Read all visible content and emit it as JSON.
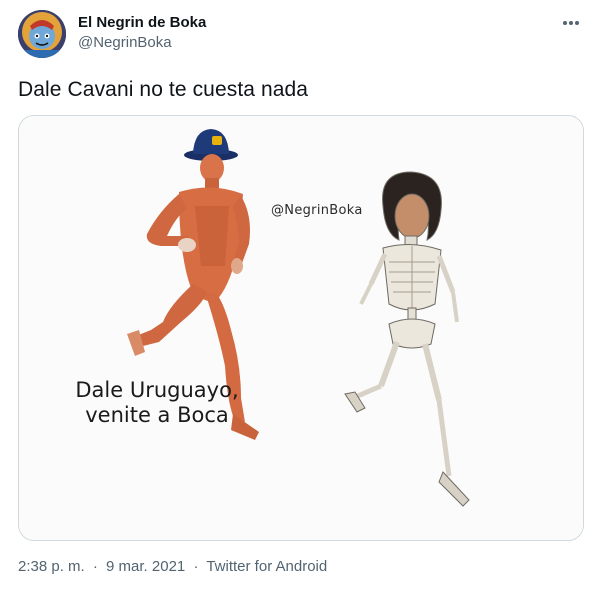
{
  "author": {
    "display_name": "El Negrin de Boka",
    "handle": "@NegrinBoka",
    "avatar_icon": "avatar-image"
  },
  "more_icon": "more-options-icon",
  "tweet": {
    "text": "Dale Cavani no te cuesta nada"
  },
  "media": {
    "watermark": "@NegrinBoka",
    "caption_line1": "Dale Uruguayo,",
    "caption_line2": "venite a Boca"
  },
  "meta": {
    "time": "2:38 p. m.",
    "separator1": "·",
    "date": "9 mar. 2021",
    "separator2": "·",
    "source": "Twitter for Android"
  },
  "colors": {
    "text_primary": "#0f1419",
    "text_secondary": "#536471",
    "border": "#cfd9de",
    "hat_blue": "#1f3a78",
    "hat_gold": "#e8b20e"
  }
}
